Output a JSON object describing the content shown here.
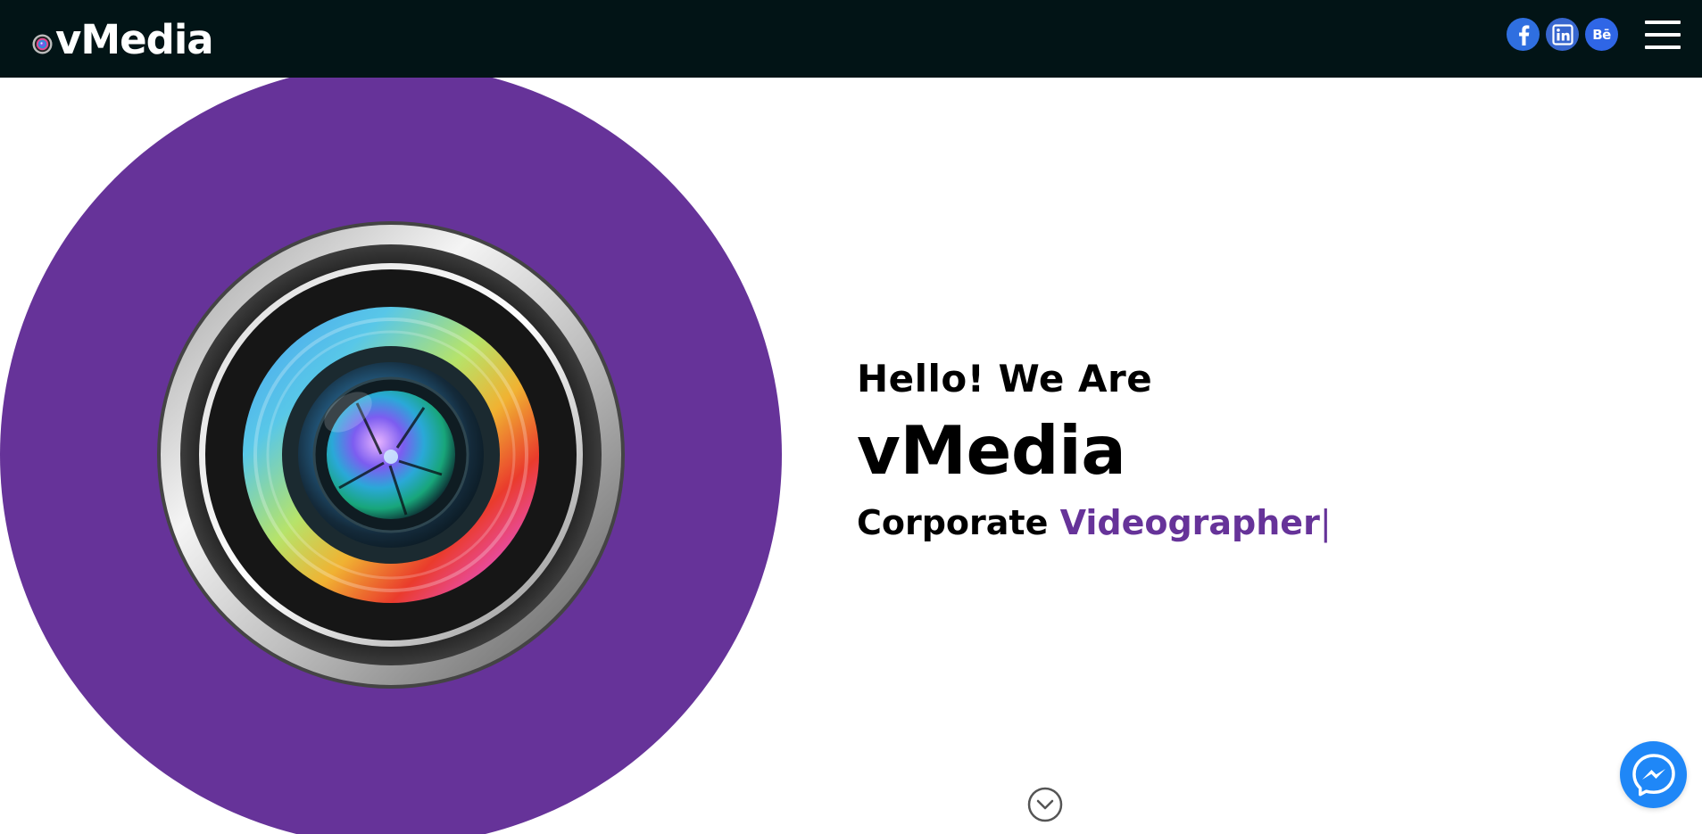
{
  "header": {
    "logo_text": "vMedia",
    "social": [
      {
        "name": "facebook",
        "icon": "facebook-icon",
        "label": "f"
      },
      {
        "name": "linkedin",
        "icon": "linkedin-icon",
        "label": "in"
      },
      {
        "name": "behance",
        "icon": "behance-icon",
        "label": "Bē"
      }
    ],
    "menu_icon": "hamburger-menu-icon"
  },
  "hero": {
    "greeting": "Hello! We Are",
    "brand": "vMedia",
    "role_prefix": "Corporate",
    "role_accent": "Videographer",
    "role_cursor": "|",
    "image": "camera-lens-illustration",
    "scroll_icon": "chevron-down-circle-icon"
  },
  "chat_widget": {
    "icon": "messenger-icon"
  },
  "colors": {
    "header_bg": "#021416",
    "accent_purple": "#663399",
    "social_blue": "#2f66e6",
    "messenger_blue": "#1f87f7",
    "text": "#000000",
    "background": "#ffffff"
  }
}
